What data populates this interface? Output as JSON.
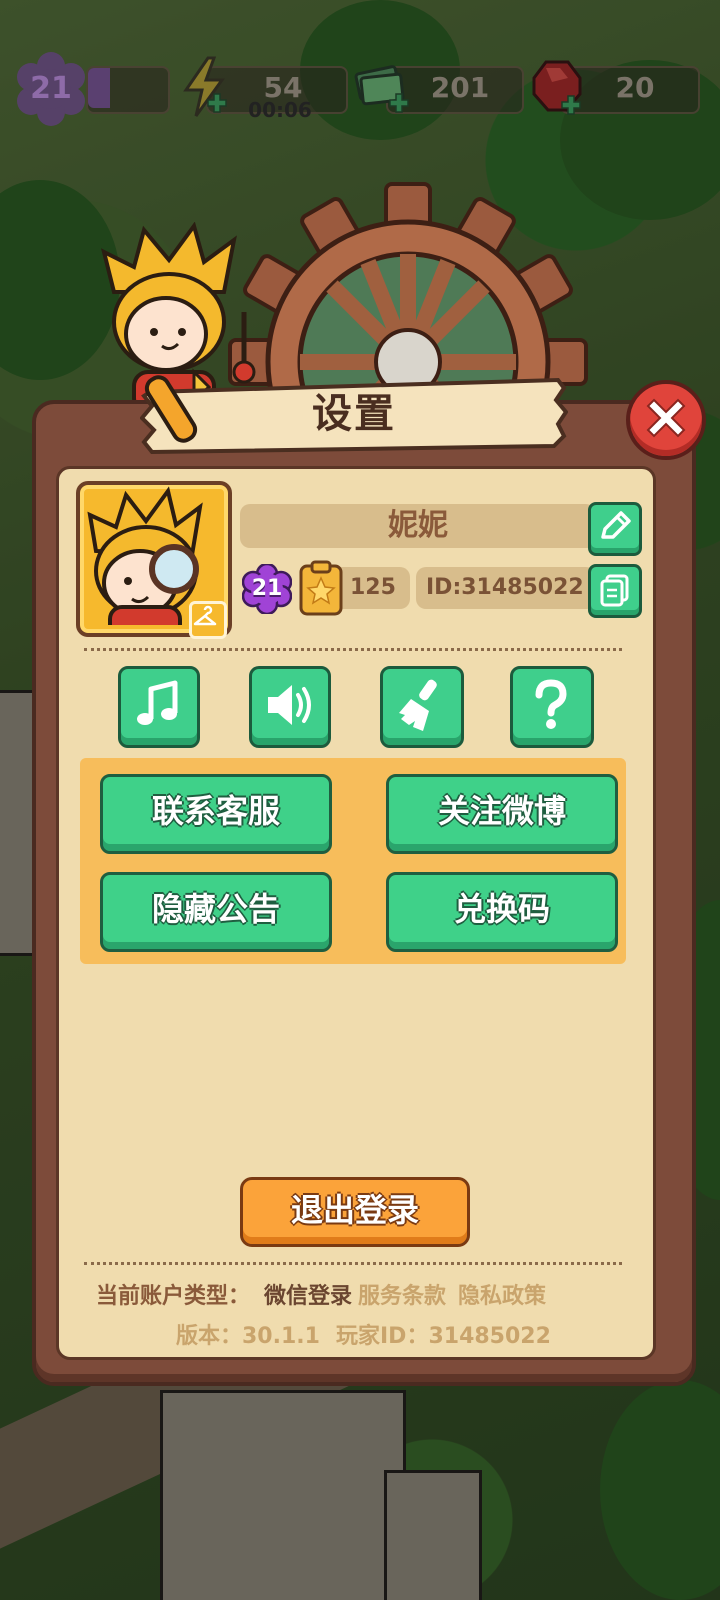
{
  "hud": {
    "level": "21",
    "energy": "54",
    "energy_timer": "00:06",
    "cash": "201",
    "gems": "20"
  },
  "panel": {
    "title": "设置",
    "player_name": "妮妮",
    "player_level": "21",
    "stars": "125",
    "id_label": "ID:31485022"
  },
  "buttons": {
    "contact_service": "联系客服",
    "follow_weibo": "关注微博",
    "hide_notice": "隐藏公告",
    "redeem_code": "兑换码",
    "logout": "退出登录"
  },
  "footer": {
    "account_type_label": "当前账户类型：",
    "account_type_value": "微信登录",
    "terms": "服务条款",
    "privacy": "隐私政策",
    "version": "版本：30.1.1",
    "player_id": "玩家ID：31485022"
  },
  "icons": {
    "music": "music-note-icon",
    "sound": "speaker-icon",
    "clean": "broom-icon",
    "help": "question-icon",
    "edit": "pencil-icon",
    "copy": "copy-icon",
    "close": "close-icon"
  },
  "colors": {
    "button_green": "#3fcf8c",
    "button_orange": "#fba33a",
    "close_red": "#e0443b",
    "panel_brown": "#7d4b3a",
    "panel_cream": "#f0dcae"
  }
}
